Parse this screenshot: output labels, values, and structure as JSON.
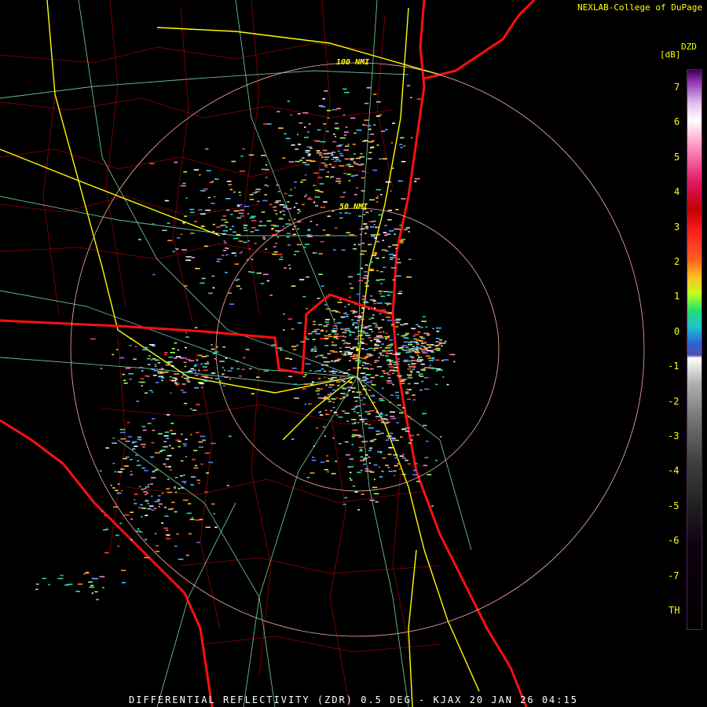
{
  "header": {
    "credit": "NEXLAB-College of DuPage"
  },
  "map": {
    "ring_labels": [
      "100 NMI",
      "50 NMI"
    ],
    "radar_site": "KJAX"
  },
  "scale": {
    "title": "DZD",
    "units": "[dB]",
    "ticks": [
      "7",
      "6",
      "5",
      "4",
      "3",
      "2",
      "1",
      "0",
      "-1",
      "-2",
      "-3",
      "-4",
      "-5",
      "-6",
      "-7",
      "TH"
    ]
  },
  "footer": {
    "caption": "DIFFERENTIAL REFLECTIVITY (ZDR) 0.5 DEG - KJAX 20 JAN 26 04:15"
  },
  "colors": {
    "coast": "#ff0000",
    "state_border": "#ff0000",
    "county": "#cc0000",
    "highway": "#ffff00",
    "road": "#7fdcaa",
    "ring": "#ffb0a0",
    "text": "#ffff00"
  }
}
